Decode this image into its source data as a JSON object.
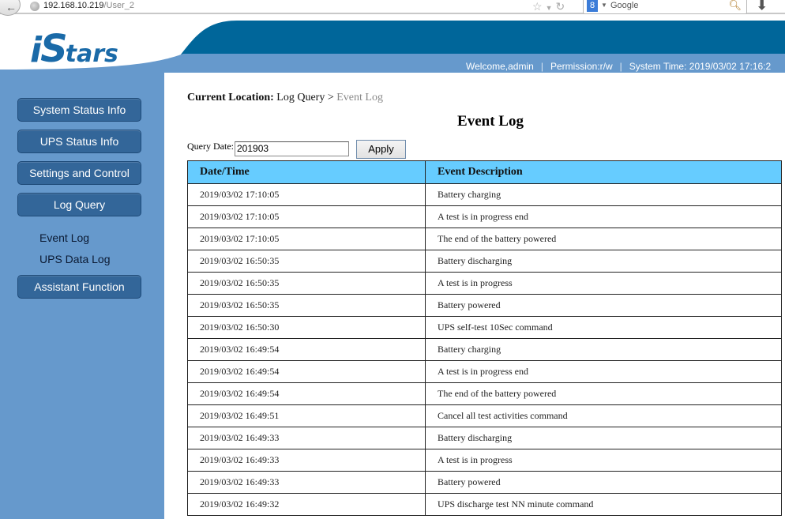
{
  "browser": {
    "url_host": "192.168.10.219",
    "url_path": "/User_2",
    "search_placeholder": "Google"
  },
  "header": {
    "logo_i": "i",
    "logo_S": "S",
    "logo_rest": "tars",
    "welcome": "Welcome,admin",
    "separator": "|",
    "permission": "Permission:r/w",
    "system_time": "System Time: 2019/03/02 17:16:2"
  },
  "sidebar": {
    "buttons": [
      {
        "label": "System Status Info"
      },
      {
        "label": "UPS Status Info"
      },
      {
        "label": "Settings and Control"
      },
      {
        "label": "Log Query"
      }
    ],
    "subitems": [
      {
        "label": "Event Log"
      },
      {
        "label": "UPS Data Log"
      }
    ],
    "assistant_label": "Assistant Function"
  },
  "content": {
    "breadcrumb_label": "Current Location:",
    "breadcrumb_parent": "Log Query",
    "breadcrumb_sep": ">",
    "breadcrumb_current": "Event Log",
    "title": "Event Log",
    "query_label": "Query Date:",
    "query_value": "201903",
    "apply_label": "Apply",
    "table": {
      "headers": [
        "Date/Time",
        "Event Description"
      ],
      "rows": [
        [
          "2019/03/02 17:10:05",
          "Battery charging"
        ],
        [
          "2019/03/02 17:10:05",
          "A test is in progress end"
        ],
        [
          "2019/03/02 17:10:05",
          "The end of the battery powered"
        ],
        [
          "2019/03/02 16:50:35",
          "Battery discharging"
        ],
        [
          "2019/03/02 16:50:35",
          "A test is in progress"
        ],
        [
          "2019/03/02 16:50:35",
          "Battery powered"
        ],
        [
          "2019/03/02 16:50:30",
          "UPS self-test 10Sec command"
        ],
        [
          "2019/03/02 16:49:54",
          "Battery charging"
        ],
        [
          "2019/03/02 16:49:54",
          "A test is in progress end"
        ],
        [
          "2019/03/02 16:49:54",
          "The end of the battery powered"
        ],
        [
          "2019/03/02 16:49:51",
          "Cancel all test activities command"
        ],
        [
          "2019/03/02 16:49:33",
          "Battery discharging"
        ],
        [
          "2019/03/02 16:49:33",
          "A test is in progress"
        ],
        [
          "2019/03/02 16:49:33",
          "Battery powered"
        ],
        [
          "2019/03/02 16:49:32",
          "UPS discharge test NN minute command"
        ]
      ]
    }
  },
  "colors": {
    "header_dark": "#00669a",
    "header_light": "#6699cc",
    "sidebar_bg": "#6699cc",
    "nav_button": "#336699",
    "table_header": "#66ccff",
    "logo": "#1a6aa8"
  }
}
